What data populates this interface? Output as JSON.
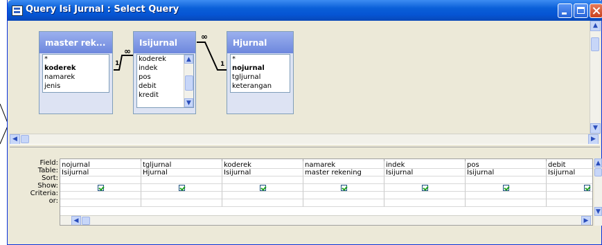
{
  "window": {
    "title": "Query Isi Jurnal : Select Query"
  },
  "tables": [
    {
      "name": "master rek...",
      "fields": [
        "*",
        "koderek",
        "namarek",
        "jenis"
      ],
      "key_field": "koderek"
    },
    {
      "name": "Isijurnal",
      "fields": [
        "koderek",
        "indek",
        "pos",
        "debit",
        "kredit"
      ],
      "key_field": ""
    },
    {
      "name": "Hjurnal",
      "fields": [
        "*",
        "nojurnal",
        "tgljurnal",
        "keterangan"
      ],
      "key_field": "nojurnal"
    }
  ],
  "relations": {
    "one_label": "1",
    "many_label": "∞"
  },
  "grid": {
    "row_labels": [
      "Field:",
      "Table:",
      "Sort:",
      "Show:",
      "Criteria:",
      "or:"
    ],
    "columns": [
      {
        "field": "nojurnal",
        "table": "Isijurnal",
        "show": true
      },
      {
        "field": "tgljurnal",
        "table": "Hjurnal",
        "show": true
      },
      {
        "field": "koderek",
        "table": "Isijurnal",
        "show": true
      },
      {
        "field": "namarek",
        "table": "master rekening",
        "show": true
      },
      {
        "field": "indek",
        "table": "Isijurnal",
        "show": true
      },
      {
        "field": "pos",
        "table": "Isijurnal",
        "show": true
      },
      {
        "field": "debit",
        "table": "Isijurnal",
        "show": true
      }
    ]
  },
  "icons": {
    "app": "query-icon",
    "minimize": "minimize-icon",
    "maximize": "maximize-icon",
    "close": "close-icon"
  }
}
